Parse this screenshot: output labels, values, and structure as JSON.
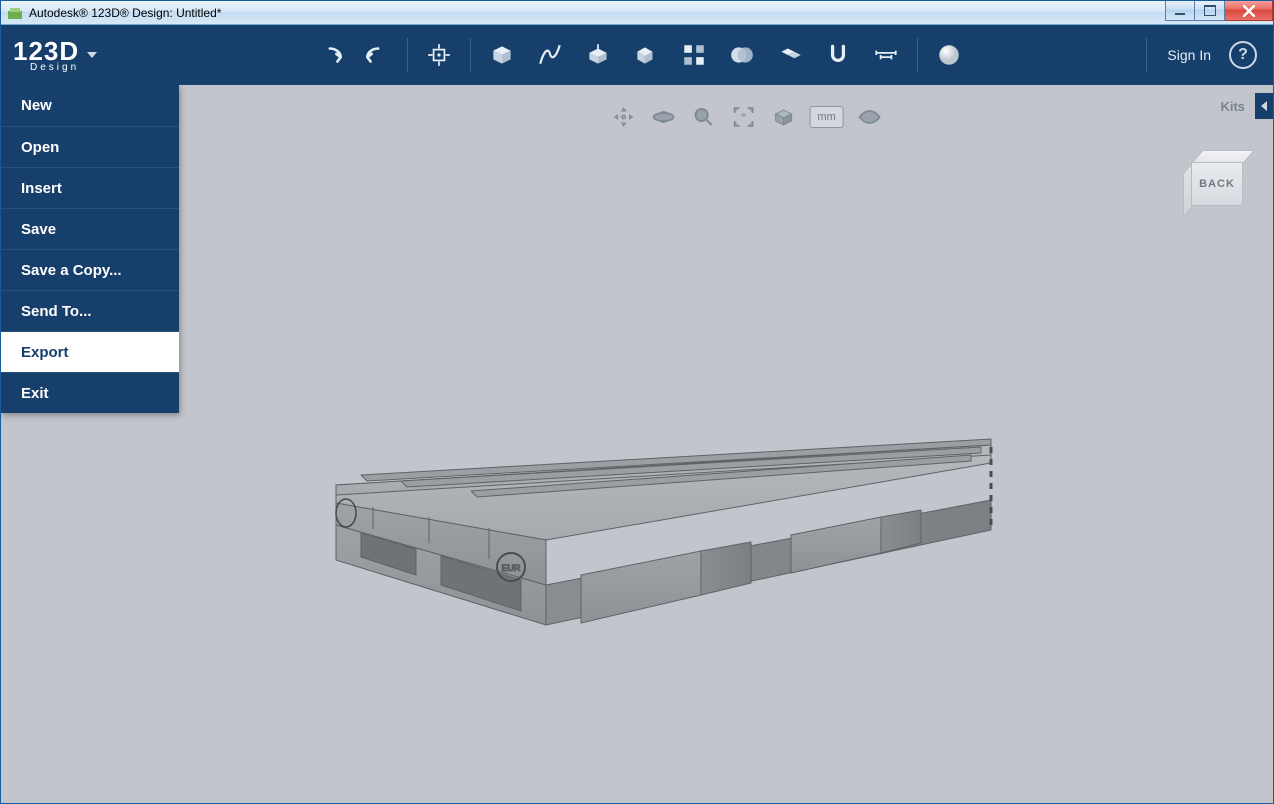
{
  "titlebar": {
    "text": "Autodesk® 123D® Design: Untitled*"
  },
  "logo": {
    "main": "123D",
    "sub": "Design"
  },
  "toolbar": {
    "signin": "Sign In",
    "help": "?"
  },
  "menu": {
    "items": [
      {
        "label": "New"
      },
      {
        "label": "Open"
      },
      {
        "label": "Insert"
      },
      {
        "label": "Save"
      },
      {
        "label": "Save a Copy..."
      },
      {
        "label": "Send To..."
      },
      {
        "label": "Export",
        "hover": true
      },
      {
        "label": "Exit"
      }
    ]
  },
  "view_toolbar": {
    "units": "mm"
  },
  "kits": {
    "label": "Kits"
  },
  "viewcube": {
    "face": "BACK"
  }
}
